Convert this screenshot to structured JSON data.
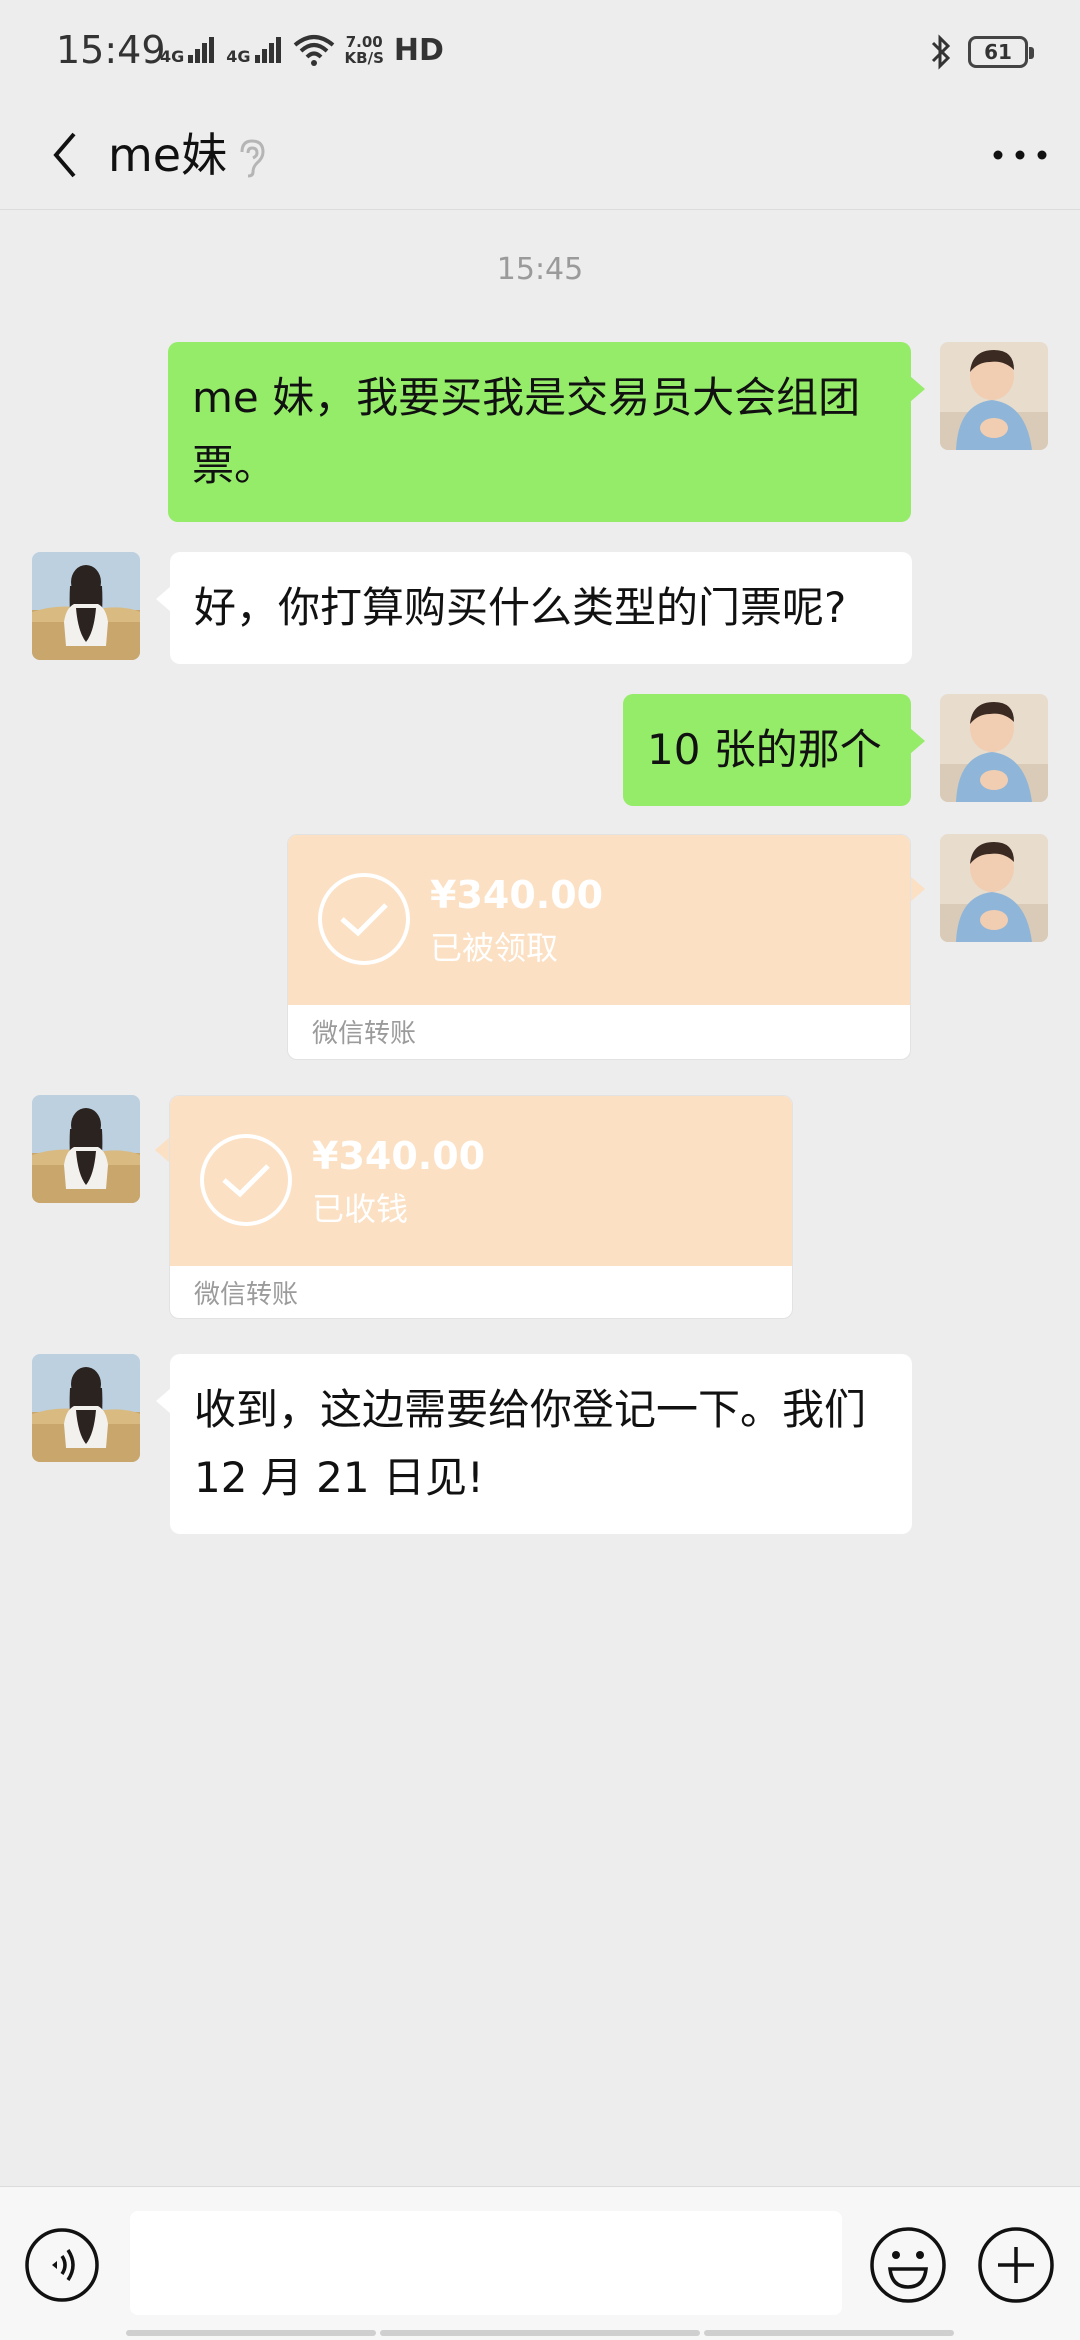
{
  "status_bar": {
    "time": "15:49",
    "network_1": "4G",
    "network_2": "4G",
    "speed_value": "7.00",
    "speed_unit": "KB/S",
    "hd": "HD",
    "battery": "61"
  },
  "header": {
    "title": "me妹"
  },
  "chat": {
    "timestamp": "15:45",
    "messages": [
      {
        "side": "me",
        "type": "text",
        "text": "me 妹，我要买我是交易员大会组团票。"
      },
      {
        "side": "them",
        "type": "text",
        "text": "好，你打算购买什么类型的门票呢?"
      },
      {
        "side": "me",
        "type": "text",
        "text": "10 张的那个"
      },
      {
        "side": "me",
        "type": "transfer",
        "amount": "¥340.00",
        "status": "已被领取",
        "label": "微信转账"
      },
      {
        "side": "them",
        "type": "transfer",
        "amount": "¥340.00",
        "status": "已收钱",
        "label": "微信转账"
      },
      {
        "side": "them",
        "type": "text",
        "text": "收到，这边需要给你登记一下。我们 12 月 21 日见!"
      }
    ]
  },
  "input_bar": {
    "placeholder": ""
  },
  "colors": {
    "background": "#ededed",
    "my_bubble": "#95ec69",
    "their_bubble": "#ffffff",
    "transfer": "#fbe0c3"
  }
}
